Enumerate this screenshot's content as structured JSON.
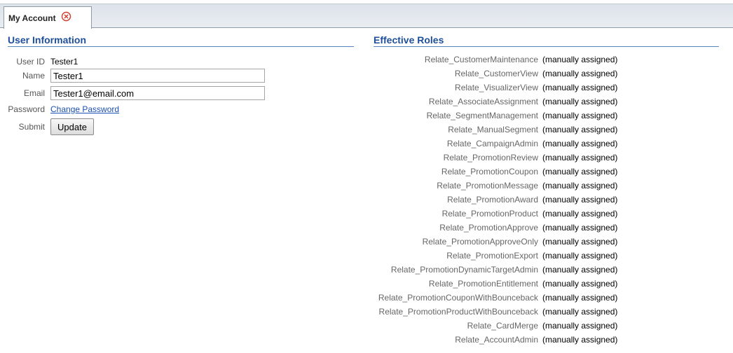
{
  "tab": {
    "label": "My Account"
  },
  "user_information": {
    "title": "User Information",
    "user_id_label": "User ID",
    "user_id_value": "Tester1",
    "name_label": "Name",
    "name_value": "Tester1",
    "email_label": "Email",
    "email_value": "Tester1@email.com",
    "password_label": "Password",
    "change_password_link": "Change Password",
    "submit_label": "Submit",
    "update_button": "Update"
  },
  "effective_roles": {
    "title": "Effective Roles",
    "roles": [
      {
        "name": "Relate_CustomerMaintenance",
        "status": "(manually assigned)"
      },
      {
        "name": "Relate_CustomerView",
        "status": "(manually assigned)"
      },
      {
        "name": "Relate_VisualizerView",
        "status": "(manually assigned)"
      },
      {
        "name": "Relate_AssociateAssignment",
        "status": "(manually assigned)"
      },
      {
        "name": "Relate_SegmentManagement",
        "status": "(manually assigned)"
      },
      {
        "name": "Relate_ManualSegment",
        "status": "(manually assigned)"
      },
      {
        "name": "Relate_CampaignAdmin",
        "status": "(manually assigned)"
      },
      {
        "name": "Relate_PromotionReview",
        "status": "(manually assigned)"
      },
      {
        "name": "Relate_PromotionCoupon",
        "status": "(manually assigned)"
      },
      {
        "name": "Relate_PromotionMessage",
        "status": "(manually assigned)"
      },
      {
        "name": "Relate_PromotionAward",
        "status": "(manually assigned)"
      },
      {
        "name": "Relate_PromotionProduct",
        "status": "(manually assigned)"
      },
      {
        "name": "Relate_PromotionApprove",
        "status": "(manually assigned)"
      },
      {
        "name": "Relate_PromotionApproveOnly",
        "status": "(manually assigned)"
      },
      {
        "name": "Relate_PromotionExport",
        "status": "(manually assigned)"
      },
      {
        "name": "Relate_PromotionDynamicTargetAdmin",
        "status": "(manually assigned)"
      },
      {
        "name": "Relate_PromotionEntitlement",
        "status": "(manually assigned)"
      },
      {
        "name": "Relate_PromotionCouponWithBounceback",
        "status": "(manually assigned)"
      },
      {
        "name": "Relate_PromotionProductWithBounceback",
        "status": "(manually assigned)"
      },
      {
        "name": "Relate_CardMerge",
        "status": "(manually assigned)"
      },
      {
        "name": "Relate_AccountAdmin",
        "status": "(manually assigned)"
      }
    ]
  }
}
